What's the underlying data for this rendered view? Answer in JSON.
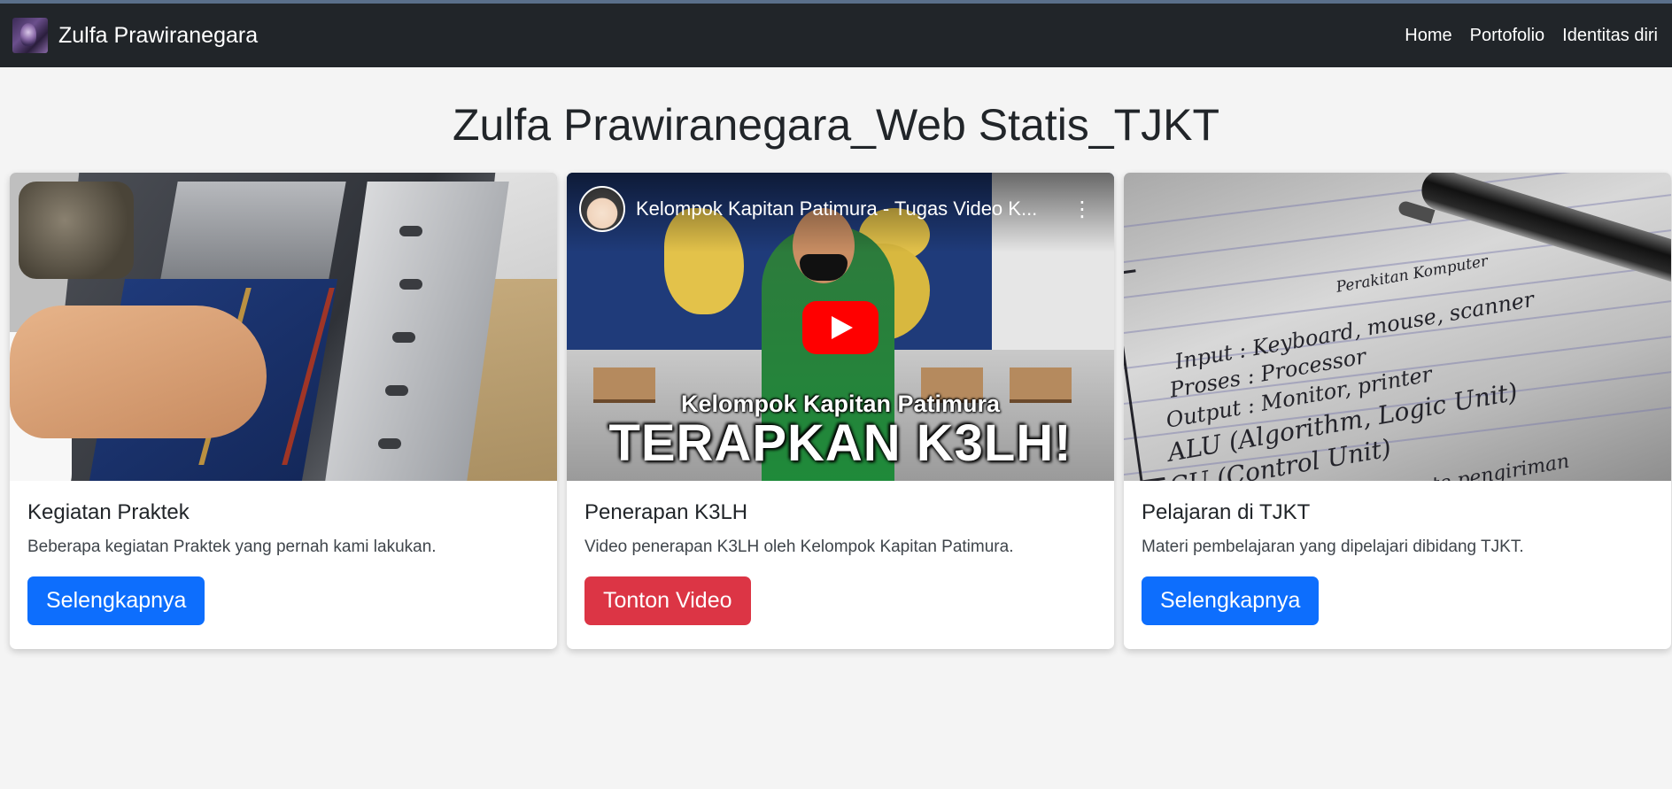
{
  "navbar": {
    "brand": "Zulfa Prawiranegara",
    "links": [
      "Home",
      "Portofolio",
      "Identitas diri"
    ]
  },
  "page": {
    "title": "Zulfa Prawiranegara_Web Statis_TJKT"
  },
  "cards": [
    {
      "title": "Kegiatan Praktek",
      "text": "Beberapa kegiatan Praktek yang pernah kami lakukan.",
      "button": "Selengkapnya",
      "button_color": "#0d6efd"
    },
    {
      "title": "Penerapan K3LH",
      "text": "Video penerapan K3LH oleh Kelompok Kapitan Patimura.",
      "button": "Tonton Video",
      "button_color": "#dc3545",
      "video": {
        "title": "Kelompok Kapitan Patimura - Tugas Video K...",
        "caption_small": "Kelompok Kapitan Patimura",
        "caption_big": "TERAPKAN K3LH!",
        "more": "⋮"
      }
    },
    {
      "title": "Pelajaran di TJKT",
      "text": "Materi pembelajaran yang dipelajari dibidang TJKT.",
      "button": "Selengkapnya",
      "button_color": "#0d6efd",
      "notes": {
        "heading": "Perakitan Komputer",
        "lines": [
          "Input : Keyboard, mouse, scanner",
          "Proses : Processor",
          "Output : Monitor, printer",
          "ALU (Algorithm, Logic Unit)",
          "CU (Control Unit)",
          "Jalur / rute pengiriman"
        ]
      }
    }
  ],
  "colors": {
    "navbar_bg": "#212529",
    "page_bg": "#f4f4f4",
    "primary": "#0d6efd",
    "danger": "#dc3545"
  }
}
